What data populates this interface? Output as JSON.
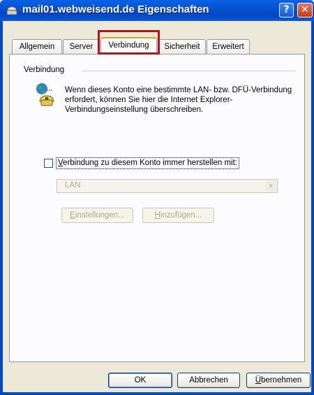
{
  "window": {
    "title": "mail01.webweisend.de Eigenschaften",
    "help_glyph": "?",
    "close_glyph": "✕"
  },
  "tabs": [
    {
      "label": "Allgemein",
      "active": false
    },
    {
      "label": "Server",
      "active": false
    },
    {
      "label": "Verbindung",
      "active": true
    },
    {
      "label": "Sicherheit",
      "active": false
    },
    {
      "label": "Erweitert",
      "active": false
    }
  ],
  "group": {
    "label": "Verbindung",
    "description": "Wenn dieses Konto eine bestimmte LAN- bzw. DFÜ-Verbindung erfordert, können Sie hier die Internet Explorer-Verbindungseinstellung überschreiben."
  },
  "checkbox": {
    "label_prefix": "",
    "label_accel": "V",
    "label_rest": "erbindung zu diesem Konto immer herstellen mit:",
    "checked": false
  },
  "connection_select": {
    "value": "LAN",
    "disabled": true
  },
  "buttons": {
    "settings": {
      "accel": "E",
      "rest": "instellungen..."
    },
    "add": {
      "accel": "H",
      "rest": "inzufügen..."
    },
    "ok": "OK",
    "cancel": "Abbrechen",
    "apply": {
      "accel": "Ü",
      "rest": "bernehmen"
    }
  },
  "colors": {
    "title_bar": "#0347c4",
    "dialog_bg": "#ece9d8",
    "highlight_box": "#b3161b"
  }
}
